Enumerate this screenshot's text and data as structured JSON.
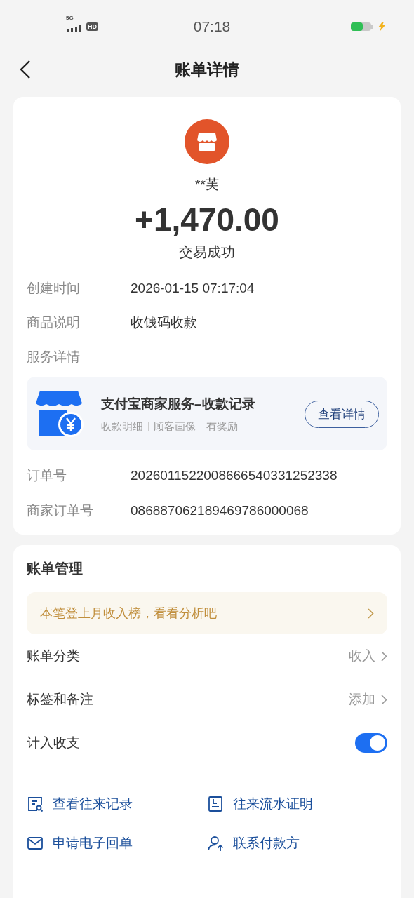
{
  "status_bar": {
    "network": "5G",
    "hd": "HD",
    "time": "07:18",
    "charging": true
  },
  "nav": {
    "title": "账单详情"
  },
  "payer": {
    "name": "**芙",
    "amount": "+1,470.00",
    "status": "交易成功"
  },
  "details": [
    {
      "label": "创建时间",
      "value": "2026-01-15 07:17:04"
    },
    {
      "label": "商品说明",
      "value": "收钱码收款"
    },
    {
      "label": "服务详情"
    }
  ],
  "service": {
    "title": "支付宝商家服务–收款记录",
    "tags": [
      "收款明细",
      "顾客画像",
      "有奖励"
    ],
    "button": "查看详情"
  },
  "order": [
    {
      "label": "订单号",
      "value": "2026011522008666540331252338"
    },
    {
      "label": "商家订单号",
      "value": "086887062189469786000068"
    }
  ],
  "management": {
    "title": "账单管理",
    "banner": "本笔登上月收入榜，看看分析吧",
    "rows": [
      {
        "kind": "link",
        "label": "账单分类",
        "value": "收入"
      },
      {
        "kind": "link",
        "label": "标签和备注",
        "value": "添加"
      },
      {
        "kind": "toggle",
        "label": "计入收支",
        "on": true
      }
    ],
    "actions": [
      {
        "kind": "records",
        "label": "查看往来记录"
      },
      {
        "kind": "proof",
        "label": "往来流水证明"
      },
      {
        "kind": "mail",
        "label": "申请电子回单"
      },
      {
        "kind": "contact",
        "label": "联系付款方"
      }
    ]
  }
}
